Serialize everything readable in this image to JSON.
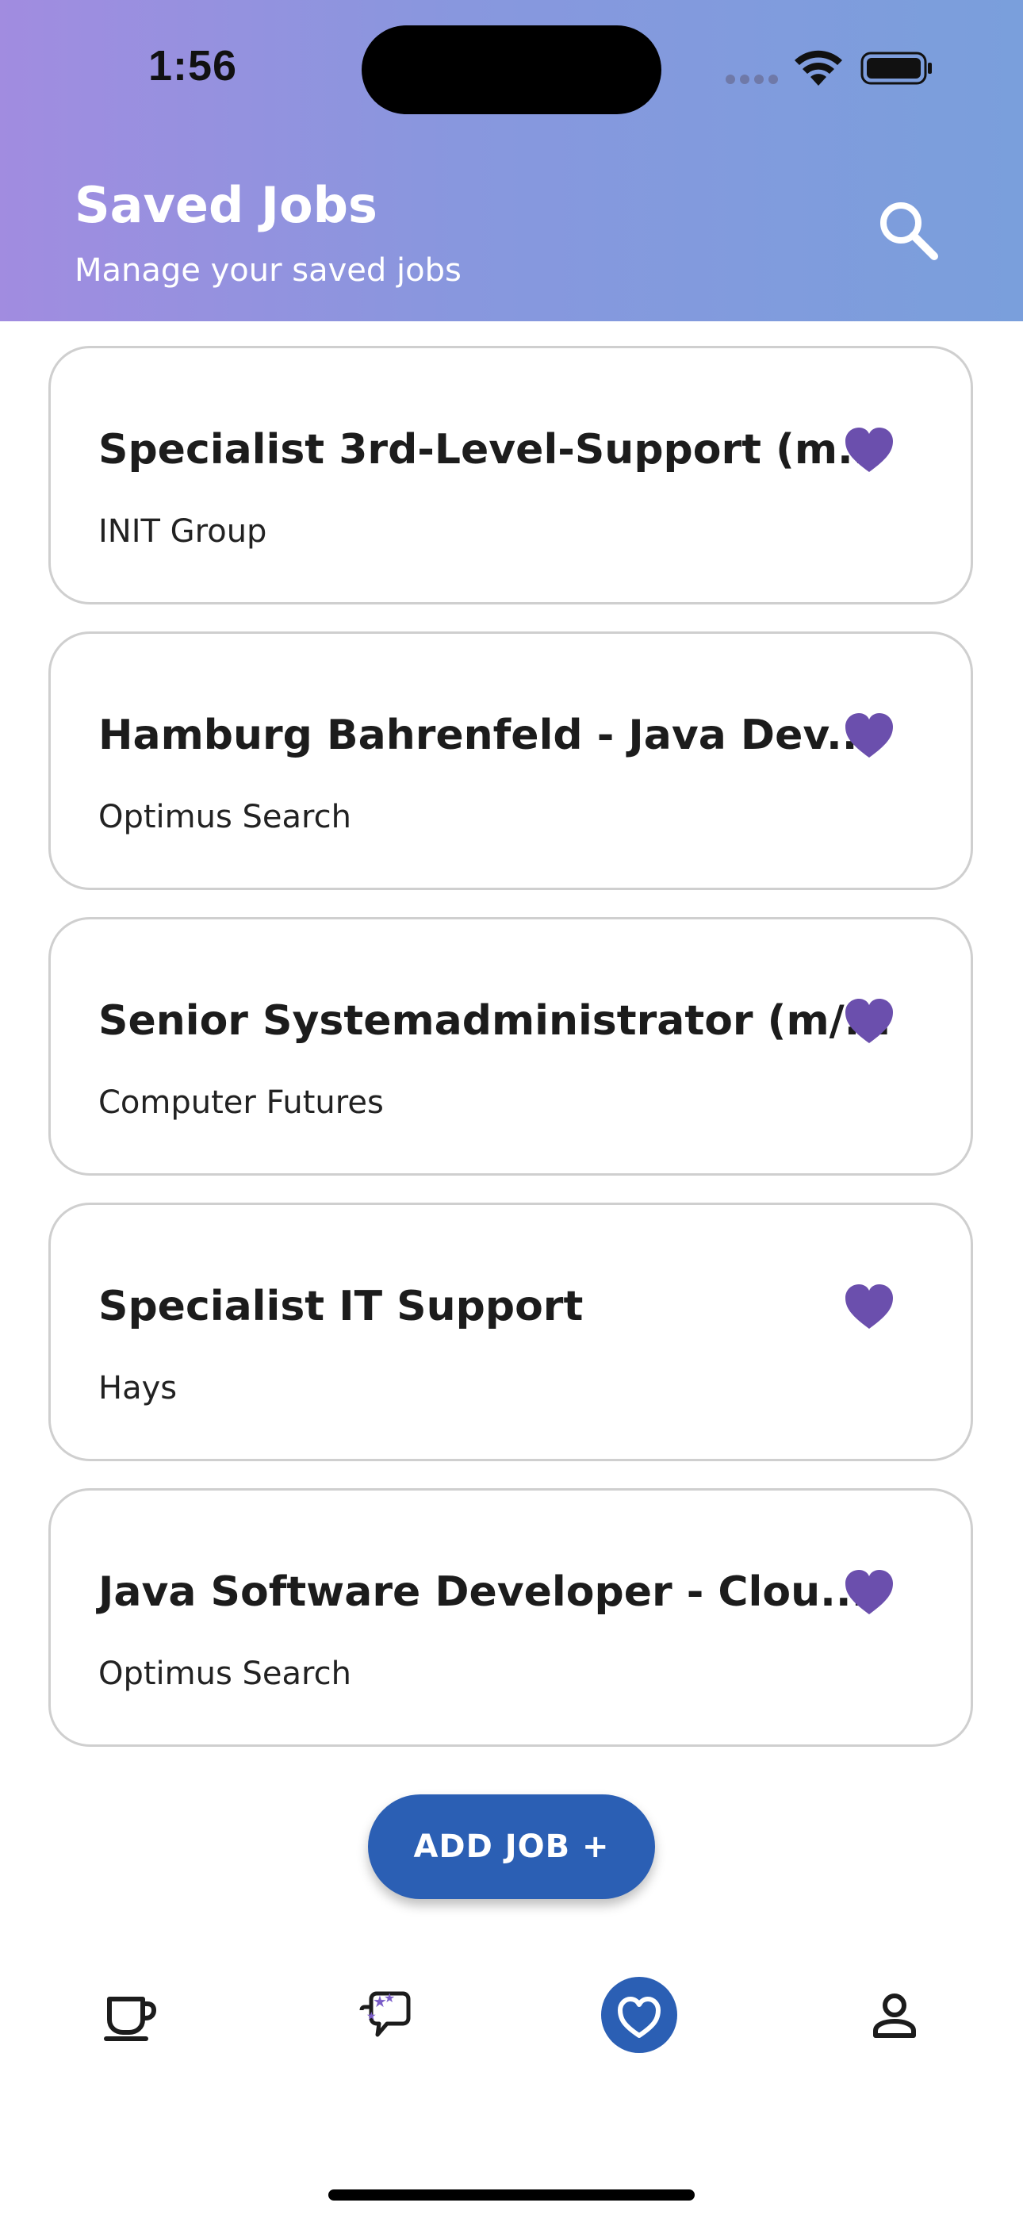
{
  "status_bar": {
    "time": "1:56"
  },
  "header": {
    "title": "Saved Jobs",
    "subtitle": "Manage your saved jobs",
    "search_icon": "search-icon"
  },
  "jobs": [
    {
      "title": "Specialist 3rd-Level-Support (m...",
      "company": "INIT Group",
      "saved": true
    },
    {
      "title": "Hamburg Bahrenfeld - Java Dev...",
      "company": "Optimus Search",
      "saved": true
    },
    {
      "title": "Senior Systemadministrator (m/...",
      "company": "Computer Futures",
      "saved": true
    },
    {
      "title": "Specialist IT Support",
      "company": "Hays",
      "saved": true
    },
    {
      "title": "Java Software Developer - Clou...",
      "company": "Optimus Search",
      "saved": true
    }
  ],
  "add_job": {
    "label": "ADD JOB +"
  },
  "bottom_nav": {
    "items": [
      {
        "icon": "coffee-cup-icon",
        "active": false
      },
      {
        "icon": "ai-chat-icon",
        "active": false
      },
      {
        "icon": "heart-icon",
        "active": true
      },
      {
        "icon": "profile-icon",
        "active": false
      }
    ]
  },
  "colors": {
    "header_gradient_start": "#a18ce0",
    "header_gradient_end": "#7a9fdc",
    "heart": "#6b4fad",
    "primary": "#2b5fb4"
  }
}
